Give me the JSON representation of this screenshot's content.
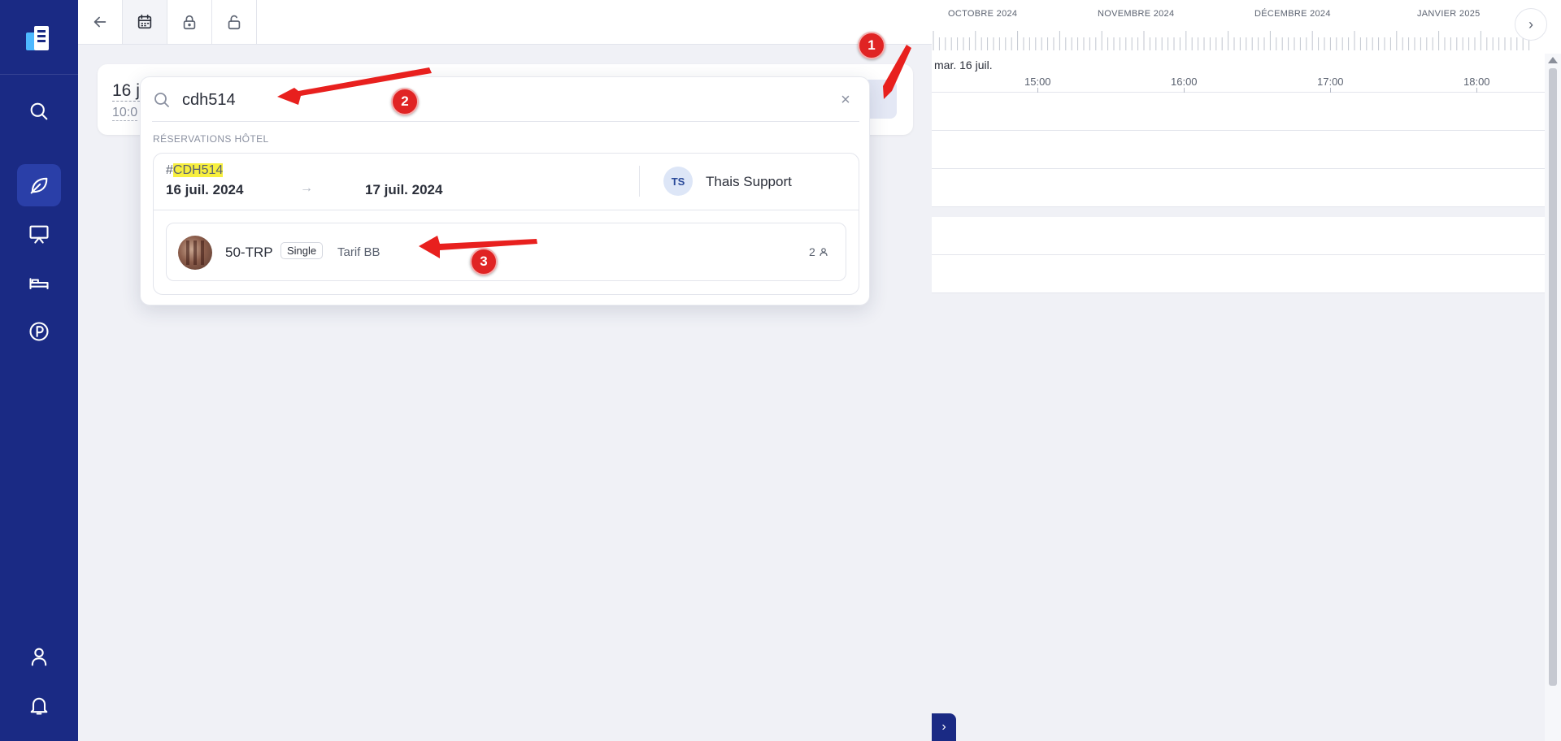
{
  "toolbar": {
    "buttons": [
      "back-arrow-icon",
      "calendar-icon",
      "lock-icon",
      "unlock-icon"
    ]
  },
  "background_card": {
    "date_partial": "16 j",
    "time_partial": "10:0"
  },
  "search": {
    "query": "cdh514",
    "clear_label": "×",
    "section_label": "RÉSERVATIONS HÔTEL"
  },
  "result": {
    "ref_prefix": "#",
    "ref_highlight": "CDH514",
    "date_from": "16 juil. 2024",
    "arrow": "→",
    "date_to": "17 juil. 2024",
    "avatar_initials": "TS",
    "user_name": "Thais Support",
    "room": {
      "name": "50-TRP",
      "type": "Single",
      "rate": "Tarif BB",
      "guests": "2"
    }
  },
  "timeline": {
    "months": [
      "OCTOBRE 2024",
      "NOVEMBRE 2024",
      "DÉCEMBRE 2024",
      "JANVIER 2025"
    ],
    "day_label": "mar. 16 juil.",
    "hours": [
      "15:00",
      "16:00",
      "17:00",
      "18:00"
    ],
    "next_label": "›",
    "expand_label": "›"
  },
  "annotations": {
    "badges": [
      "1",
      "2",
      "3"
    ],
    "color": "#e02424"
  },
  "colors": {
    "sidebar": "#1a2a84",
    "highlight": "#f7ef3e"
  }
}
